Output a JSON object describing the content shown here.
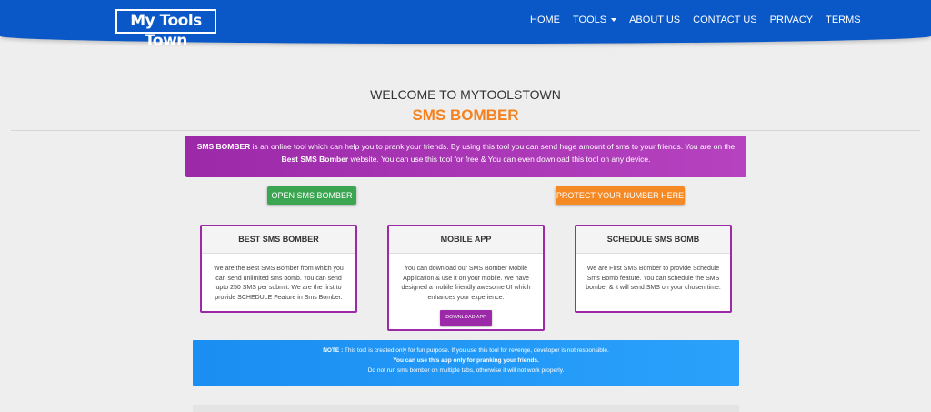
{
  "header": {
    "logo_text": "My Tools Town",
    "brand_color": "#0a58c8",
    "nav": [
      {
        "label": "HOME"
      },
      {
        "label": "TOOLS"
      },
      {
        "label": "ABOUT US"
      },
      {
        "label": "CONTACT US"
      },
      {
        "label": "PRIVACY"
      },
      {
        "label": "TERMS"
      }
    ]
  },
  "main": {
    "welcome": "WELCOME TO MYTOOLSTOWN",
    "subtitle": "SMS BOMBER",
    "intro": {
      "strong1": "SMS BOMBER",
      "text1": " is an online tool which can help you to prank your friends. By using this tool you can send huge amount of sms to your friends. You are on the ",
      "strong2": "Best SMS Bomber",
      "text2": " website. You can use this tool for free & You can even download this tool on any device."
    },
    "buttons": {
      "open": "OPEN SMS BOMBER",
      "protect": "PROTECT YOUR NUMBER HERE"
    },
    "cards": [
      {
        "title": "BEST SMS BOMBER",
        "body": "We are the Best SMS Bomber from which you can send unlimited sms bomb. You can send upto 250 SMS per submit. We are the first to provide SCHEDULE Feature in Sms Bomber."
      },
      {
        "title": "MOBILE APP",
        "body": "You can download our SMS Bomber Mobile Application & use it on your mobile. We have designed a mobile friendly awesome UI which enhances your experience.",
        "button": "DOWNLOAD APP"
      },
      {
        "title": "SCHEDULE SMS BOMB",
        "body": "We are First SMS Bomber to provide Schedule Sms Bomb feature. You can schedule the SMS bomber & it will send SMS on your chosen time."
      }
    ],
    "note": {
      "label": "NOTE :",
      "line1": " This tool is created only for fun purpose. If you use this tool for revenge, developer is not responsible.",
      "line2": "You can use this app only for pranking your friends.",
      "line3": "Do not run sms bomber on multiple tabs, otherwise it will not work properly."
    }
  },
  "colors": {
    "accent_purple": "#9c2aa8",
    "accent_orange": "#f5821f",
    "button_green": "#3ca552",
    "note_blue": "#1a8ef2"
  }
}
